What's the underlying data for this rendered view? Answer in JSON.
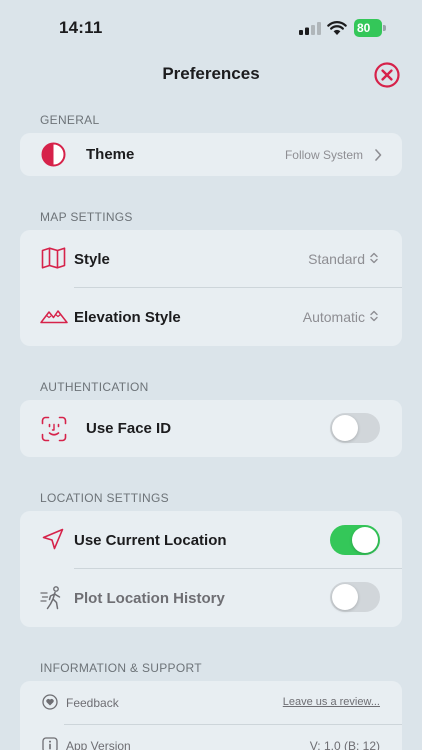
{
  "status": {
    "time": "14:11",
    "battery": "80"
  },
  "nav": {
    "title": "Preferences"
  },
  "general": {
    "header": "GENERAL",
    "theme": {
      "label": "Theme",
      "value": "Follow System",
      "icon": "half-circle-icon"
    }
  },
  "map_settings": {
    "header": "MAP SETTINGS",
    "style": {
      "label": "Style",
      "value": "Standard",
      "icon": "map-icon"
    },
    "elevation": {
      "label": "Elevation Style",
      "value": "Automatic",
      "icon": "mountains-icon"
    }
  },
  "authentication": {
    "header": "AUTHENTICATION",
    "face_id": {
      "label": "Use Face ID",
      "enabled": false,
      "icon": "face-id-icon"
    }
  },
  "location_settings": {
    "header": "LOCATION SETTINGS",
    "current_location": {
      "label": "Use Current Location",
      "enabled": true,
      "icon": "location-arrow-icon"
    },
    "plot_history": {
      "label": "Plot Location History",
      "enabled": false,
      "icon": "walking-figure-icon"
    }
  },
  "info_support": {
    "header": "INFORMATION & SUPPORT",
    "feedback": {
      "label": "Feedback",
      "link": "Leave us a review...",
      "icon": "heart-icon"
    },
    "app_version": {
      "label": "App Version",
      "value": "V: 1.0 (B: 12)",
      "icon": "info-icon"
    }
  },
  "colors": {
    "accent": "#d6224a",
    "switch_on": "#34c759",
    "background": "#dbe4ea",
    "card": "#e8eef2"
  }
}
